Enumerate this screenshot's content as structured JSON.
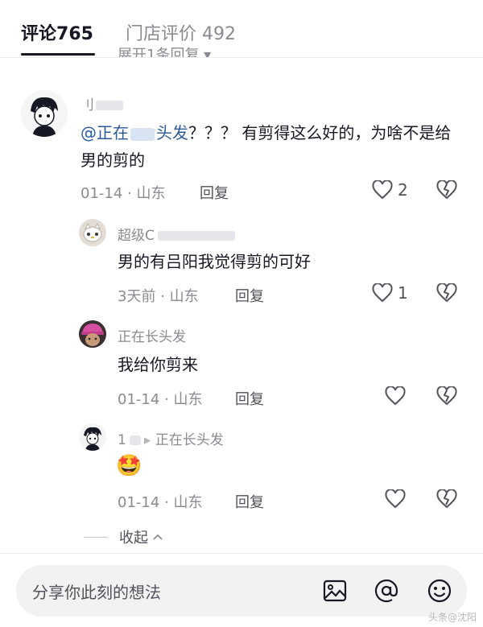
{
  "tabs": {
    "comments_label": "评论",
    "comments_count": "765",
    "store_reviews_label": "门店评价",
    "store_reviews_count": "492",
    "expand_peek": "展开1条回复 ▾"
  },
  "comments": [
    {
      "username": "刂",
      "mention": "@正在",
      "mention_tail": "头发",
      "text": "？？？ 有剪得这么好的，为啥不是给男的剪的",
      "date": "01-14",
      "location": "山东",
      "reply_label": "回复",
      "likes": "2"
    },
    {
      "username": "超级C",
      "text": "男的有吕阳我觉得剪的可好",
      "date": "3天前",
      "location": "山东",
      "reply_label": "回复",
      "likes": "1"
    },
    {
      "username": "正在长头发",
      "text": "我给你剪来",
      "date": "01-14",
      "location": "山东",
      "reply_label": "回复",
      "likes": ""
    },
    {
      "username": "1",
      "username_reply_target": "正在长头发",
      "text": "🤩",
      "date": "01-14",
      "location": "山东",
      "reply_label": "回复",
      "likes": ""
    }
  ],
  "separator": "·",
  "collapse_label": "收起",
  "input": {
    "placeholder": "分享你此刻的想法"
  },
  "icons": [
    "image-icon",
    "at-icon",
    "emoji-icon",
    "heart-icon",
    "broken-heart-icon",
    "chevron-up-icon"
  ],
  "watermark": "头条@沈阳"
}
